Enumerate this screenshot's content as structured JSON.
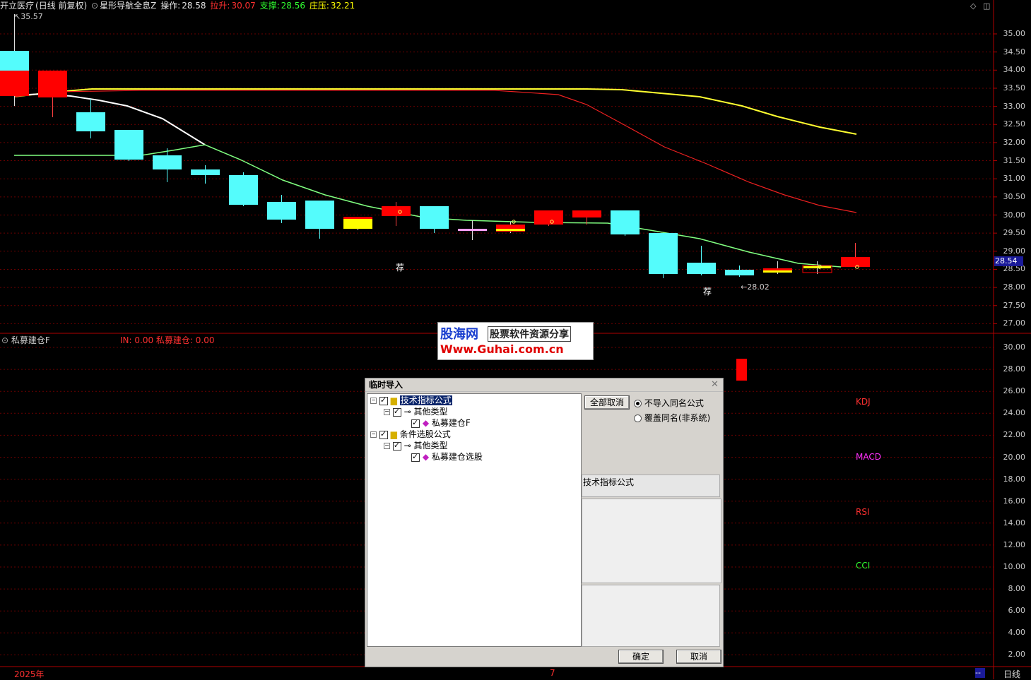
{
  "header": {
    "stock": "开立医疗",
    "period": "(日线 前复权)",
    "indicator": "星形导航全息Z",
    "op_label": "操作:",
    "op_value": "28.58",
    "rise_label": "拉升:",
    "rise_value": "30.07",
    "support_label": "支撑:",
    "support_value": "28.56",
    "press_label": "庄压:",
    "press_value": "32.21"
  },
  "colors": {
    "up": "#ff0000",
    "down": "#54fcfc",
    "yellow": "#ffff00",
    "grid": "#b00000"
  },
  "price_axis": [
    "35.00",
    "34.50",
    "34.00",
    "33.50",
    "33.00",
    "32.50",
    "32.00",
    "31.50",
    "31.00",
    "30.50",
    "30.00",
    "29.50",
    "29.00",
    "28.50",
    "28.00",
    "27.50",
    "27.00"
  ],
  "price_tag": "28.54",
  "annotations": {
    "high": "35.57",
    "low": "28.02",
    "rec1": "荐",
    "rec2": "荐"
  },
  "sub": {
    "title": "私募建仓F",
    "in_label": "IN: 0.00",
    "name_label": "私募建仓: 0.00",
    "axis": [
      "30.00",
      "28.00",
      "26.00",
      "24.00",
      "22.00",
      "20.00",
      "18.00",
      "16.00",
      "14.00",
      "12.00",
      "10.00",
      "8.00",
      "6.00",
      "4.00",
      "2.00"
    ],
    "tags": [
      "KDJ",
      "MACD",
      "RSI",
      "CCI"
    ]
  },
  "watermark": {
    "brand": "股海网",
    "slogan": "股票软件资源分享",
    "url": "Www.Guhai.com.cn"
  },
  "bottom": {
    "year": "2025年",
    "month": "7",
    "period": "日线",
    "dash": "--"
  },
  "dialog": {
    "title": "临时导入",
    "tree": [
      "技术指标公式",
      "其他类型",
      "私募建仓F",
      "条件选股公式",
      "其他类型",
      "私募建仓选股"
    ],
    "cancel_all": "全部取消",
    "opt1": "不导入同名公式",
    "opt2": "覆盖同名(非系统)",
    "info_title": "技术指标公式",
    "ok": "确定",
    "cancel": "取消"
  }
}
